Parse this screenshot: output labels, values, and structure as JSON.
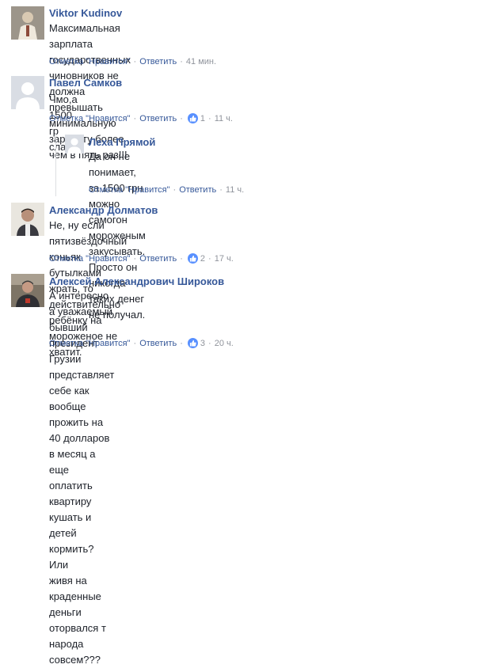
{
  "comments": [
    {
      "author": "Viktor Kudinov",
      "text_lines": [
        "Максимальная зарплата государственных чиновников не должна превышать",
        "минимальную зарплату более чем в пять раз!!!"
      ],
      "like_label": "Отметка \"Нравится\"",
      "reply_label": "Ответить",
      "time": "41 мин.",
      "likes": ""
    },
    {
      "author": "Павел Самков",
      "text_lines": [
        "Чмо,а 1500 гр слабо?"
      ],
      "like_label": "Отметка \"Нравится\"",
      "reply_label": "Ответить",
      "time": "11 ч.",
      "likes": "1"
    },
    {
      "author": "Леха Прямой",
      "text_lines": [
        "Да он не понимает, за 1500 грн можно самогон мороженым закусывать. Просто он",
        "никогда таких денег не получал."
      ],
      "like_label": "Отметка \"Нравится\"",
      "reply_label": "Ответить",
      "time": "11 ч.",
      "likes": ""
    },
    {
      "author": "Александр Долматов",
      "text_lines": [
        "Не, ну если пятизвёздочный коньяк бутылками жрать, то действительно ребёнку на",
        "мороженое не хватит."
      ],
      "like_label": "Отметка \"Нравится\"",
      "reply_label": "Ответить",
      "time": "17 ч.",
      "likes": "2"
    },
    {
      "author": "Алексей Александрович Широков",
      "text_lines": [
        "А интересно а уважаемый бывший президент Грузии представляет себе как вообще",
        "прожить на 40 долларов в месяц а еще оплатить квартиру кушать и детей кормить? Или",
        "живя на краденные деньги оторвался т народа совсем???"
      ],
      "like_label": "Отметка \"Нравится\"",
      "reply_label": "Ответить",
      "time": "20 ч.",
      "likes": "3"
    }
  ],
  "colors": {
    "link": "#365899",
    "meta": "#90949c",
    "like_badge": "#5890ff"
  }
}
